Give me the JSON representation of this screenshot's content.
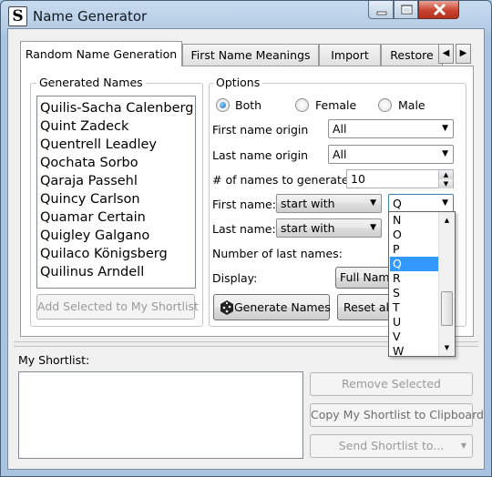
{
  "window": {
    "title": "Name Generator",
    "icon_letter": "S"
  },
  "tabs": [
    {
      "label": "Random Name Generation"
    },
    {
      "label": "First Name Meanings"
    },
    {
      "label": "Import"
    },
    {
      "label": "Restore"
    }
  ],
  "generated": {
    "legend": "Generated Names",
    "names": [
      "Quilis-Sacha Calenberg",
      "Quint Zadeck",
      "Quentrell Leadley",
      "Qochata Sorbo",
      "Qaraja Passehl",
      "Quincy Carlson",
      "Quamar Certain",
      "Quigley Galgano",
      "Quilaco Königsberg",
      "Quilinus Arndell"
    ],
    "add_button": "Add Selected to My Shortlist"
  },
  "options": {
    "legend": "Options",
    "gender": {
      "both": "Both",
      "female": "Female",
      "male": "Male",
      "selected": "both"
    },
    "first_origin_label": "First name origin",
    "first_origin_value": "All",
    "last_origin_label": "Last name origin",
    "last_origin_value": "All",
    "count_label": "# of names to generate:",
    "count_value": "10",
    "first_name_label": "First name:",
    "first_name_mode": "start with",
    "first_name_letter": "Q",
    "last_name_label": "Last name:",
    "last_name_mode": "start with",
    "num_last_label": "Number of last names:",
    "display_label": "Display:",
    "display_value": "Full Name",
    "generate_button": "Generate Names",
    "reset_button": "Reset all"
  },
  "dropdown": {
    "options": [
      "N",
      "O",
      "P",
      "Q",
      "R",
      "S",
      "T",
      "U",
      "V",
      "W"
    ],
    "selected": "Q"
  },
  "shortlist": {
    "label": "My Shortlist:",
    "remove_button": "Remove Selected",
    "copy_button": "Copy My Shortlist to Clipboard",
    "send_button": "Send Shortlist to..."
  }
}
